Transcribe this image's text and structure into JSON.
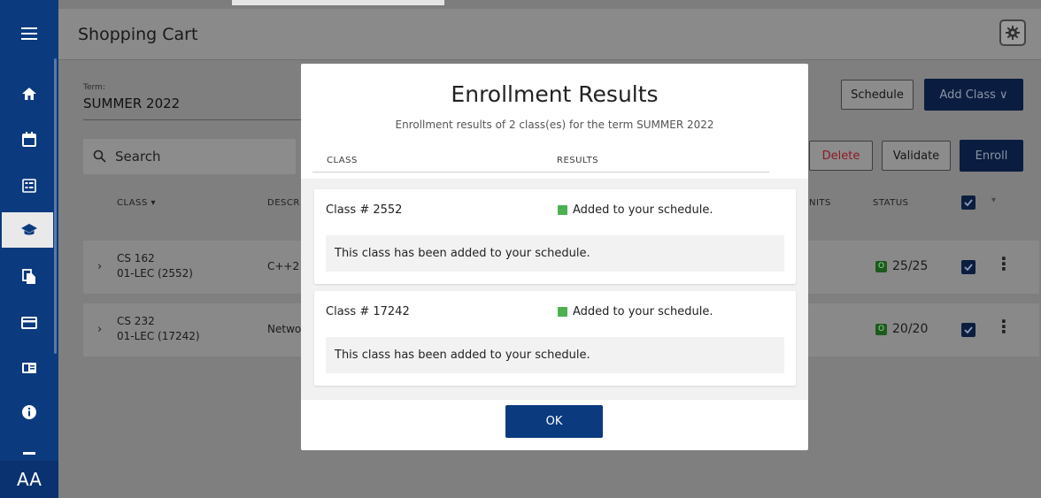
{
  "sidebar": {
    "items": [
      {
        "icon": "menu-icon"
      },
      {
        "icon": "home-icon"
      },
      {
        "icon": "calendar-icon"
      },
      {
        "icon": "grid-icon"
      },
      {
        "icon": "graduation-cap-icon"
      },
      {
        "icon": "documents-icon"
      },
      {
        "icon": "credit-card-icon"
      },
      {
        "icon": "id-card-icon"
      },
      {
        "icon": "info-icon"
      },
      {
        "icon": "more-icon"
      }
    ],
    "text_size_label": "AA"
  },
  "header": {
    "title": "Shopping Cart"
  },
  "term": {
    "label": "Term:",
    "value": "SUMMER 2022"
  },
  "actions": {
    "schedule": "Schedule",
    "add_class": "Add Class ∨",
    "delete": "Delete",
    "validate": "Validate",
    "enroll": "Enroll"
  },
  "search": {
    "placeholder": "Search"
  },
  "table": {
    "headers": {
      "class": "CLASS ▾",
      "description": "DESCR",
      "units": "NITS",
      "status": "STATUS"
    },
    "rows": [
      {
        "code": "CS 162",
        "section": "01-LEC (2552)",
        "description": "C++2",
        "seats_icon": "O",
        "seats": "25/25"
      },
      {
        "code": "CS 232",
        "section": "01-LEC (17242)",
        "description": "Netwo",
        "seats_icon": "O",
        "seats": "20/20"
      }
    ]
  },
  "modal": {
    "title": "Enrollment Results",
    "subtitle": "Enrollment results of 2 class(es) for the term SUMMER 2022",
    "col_class": "CLASS",
    "col_results": "RESULTS",
    "results": [
      {
        "class": "Class # 2552",
        "status": "Added to your schedule.",
        "message": "This class has been added to your schedule."
      },
      {
        "class": "Class # 17242",
        "status": "Added to your schedule.",
        "message": "This class has been added to your schedule."
      }
    ],
    "ok_label": "OK"
  },
  "colors": {
    "sidebar": "#0b3a7e",
    "primary_button": "#0b3a7e",
    "success": "#4cb050",
    "delete_text": "#a51f2a"
  }
}
